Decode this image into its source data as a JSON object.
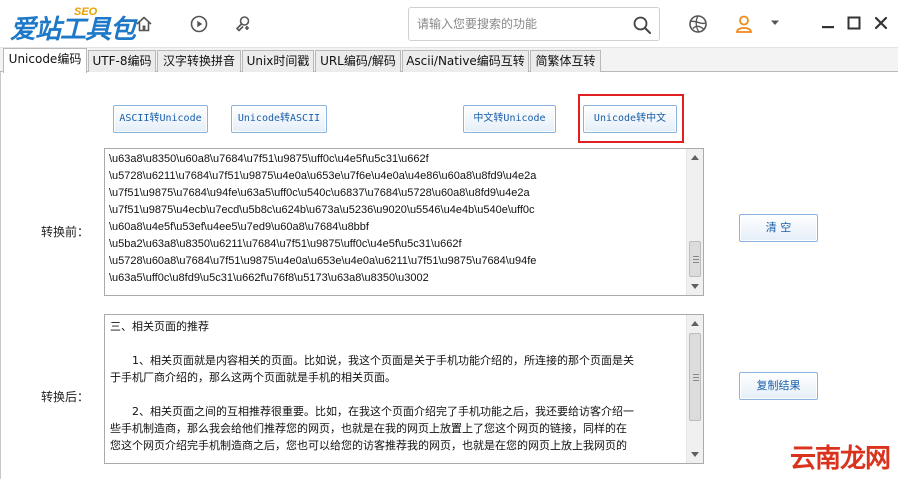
{
  "app": {
    "logo_text": "爱站工具包",
    "logo_sup": "SEO",
    "search": {
      "placeholder": "请输入您要搜索的功能"
    }
  },
  "tabs": [
    {
      "label": "Unicode编码",
      "active": true
    },
    {
      "label": "UTF-8编码"
    },
    {
      "label": "汉字转换拼音"
    },
    {
      "label": "Unix时间戳"
    },
    {
      "label": "URL编码/解码"
    },
    {
      "label": "Ascii/Native编码互转"
    },
    {
      "label": "简繁体互转"
    }
  ],
  "buttons": {
    "ascii_to_unicode": "ASCII转Unicode",
    "unicode_to_ascii": "Unicode转ASCII",
    "chinese_to_unicode": "中文转Unicode",
    "unicode_to_chinese": "Unicode转中文",
    "clear": "清 空",
    "copy_result": "复制结果"
  },
  "labels": {
    "before": "转换前：",
    "after": "转换后："
  },
  "input_lines": [
    "\\u63a8\\u8350\\u60a8\\u7684\\u7f51\\u9875\\uff0c\\u4e5f\\u5c31\\u662f",
    "\\u5728\\u6211\\u7684\\u7f51\\u9875\\u4e0a\\u653e\\u7f6e\\u4e0a\\u4e86\\u60a8\\u8fd9\\u4e2a",
    "\\u7f51\\u9875\\u7684\\u94fe\\u63a5\\uff0c\\u540c\\u6837\\u7684\\u5728\\u60a8\\u8fd9\\u4e2a",
    "\\u7f51\\u9875\\u4ecb\\u7ecd\\u5b8c\\u624b\\u673a\\u5236\\u9020\\u5546\\u4e4b\\u540e\\uff0c",
    "\\u60a8\\u4e5f\\u53ef\\u4ee5\\u7ed9\\u60a8\\u7684\\u8bbf",
    "\\u5ba2\\u63a8\\u8350\\u6211\\u7684\\u7f51\\u9875\\uff0c\\u4e5f\\u5c31\\u662f",
    "\\u5728\\u60a8\\u7684\\u7f51\\u9875\\u4e0a\\u653e\\u4e0a\\u6211\\u7f51\\u9875\\u7684\\u94fe",
    "\\u63a5\\uff0c\\u8fd9\\u5c31\\u662f\\u76f8\\u5173\\u63a8\\u8350\\u3002"
  ],
  "output": {
    "heading": "三、相关页面的推荐",
    "lines": [
      "1、相关页面就是内容相关的页面。比如说，我这个页面是关于手机功能介绍的，所连接的那个页面是关",
      "于手机厂商介绍的，那么这两个页面就是手机的相关页面。",
      "2、相关页面之间的互相推荐很重要。比如，在我这个页面介绍完了手机功能之后，我还要给访客介绍一",
      "些手机制造商，那么我会给他们推荐您的网页，也就是在我的网页上放置上了您这个网页的链接，同样的在",
      "您这个网页介绍完手机制造商之后，您也可以给您的访客推荐我的网页，也就是在您的网页上放上我网页的"
    ]
  },
  "watermark": "云南龙网",
  "colors": {
    "accent": "#1e78c8",
    "highlight": "#e02020",
    "watermark": "#d9331e"
  }
}
